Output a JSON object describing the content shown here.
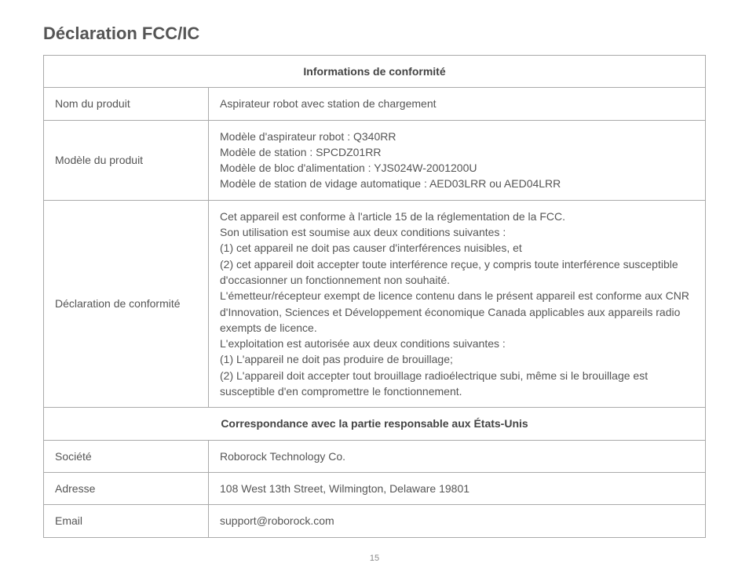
{
  "title": "Déclaration FCC/IC",
  "sections": {
    "compliance": {
      "header": "Informations de conformité",
      "rows": {
        "product_name": {
          "label": "Nom du produit",
          "value": "Aspirateur robot avec station de chargement"
        },
        "product_model": {
          "label": "Modèle du produit",
          "value": "Modèle d'aspirateur robot : Q340RR\nModèle de station : SPCDZ01RR\nModèle de bloc d'alimentation : YJS024W-2001200U\nModèle de station de vidage automatique : AED03LRR ou AED04LRR"
        },
        "compliance_statement": {
          "label": "Déclaration de conformité",
          "value": "Cet appareil est conforme à l'article 15 de la réglementation de la FCC.\nSon utilisation est soumise aux deux conditions suivantes :\n(1) cet appareil ne doit pas causer d'interférences nuisibles, et\n(2) cet appareil doit accepter toute interférence reçue, y compris toute interférence susceptible d'occasionner un fonctionnement non souhaité.\nL'émetteur/récepteur exempt de licence contenu dans le présent appareil est conforme aux CNR d'Innovation, Sciences et Développement économique Canada applicables aux appareils radio exempts de licence.\nL'exploitation est autorisée aux deux conditions suivantes :\n(1) L'appareil ne doit pas produire de brouillage;\n(2) L'appareil doit accepter tout brouillage radioélectrique subi, même si le brouillage est susceptible d'en compromettre le fonctionnement."
        }
      }
    },
    "contact": {
      "header": "Correspondance avec la partie responsable aux États-Unis",
      "rows": {
        "company": {
          "label": "Société",
          "value": "Roborock Technology Co."
        },
        "address": {
          "label": "Adresse",
          "value": "108 West 13th Street, Wilmington, Delaware 19801"
        },
        "email": {
          "label": "Email",
          "value": "support@roborock.com"
        }
      }
    }
  },
  "page_number": "15"
}
